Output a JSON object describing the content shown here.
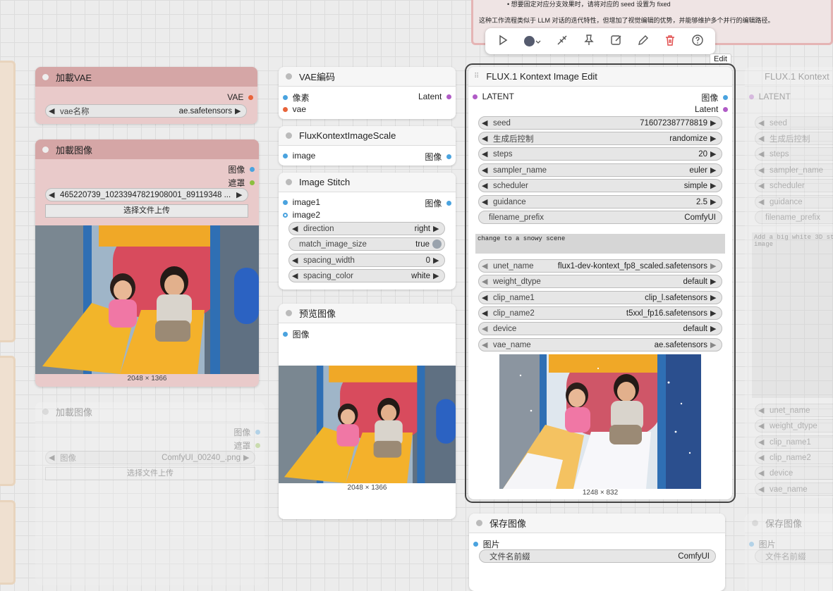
{
  "note": {
    "line1": "• 想要固定对应分支效果时，请将对应的 seed 设置为 fixed",
    "line2": "这种工作流程类似于 LLM 对话的迭代特性，但增加了视觉编辑的优势，并能够维护多个并行的编辑路径。"
  },
  "toolbar": {
    "tooltip": "Edit"
  },
  "load_vae": {
    "title": "加載VAE",
    "out": "VAE",
    "w_name": "vae名称",
    "w_value": "ae.safetensors"
  },
  "load_image": {
    "title": "加載图像",
    "out1": "图像",
    "out2": "遮罩",
    "file": "465220739_10233947821908001_89119348 ...",
    "upload": "选择文件上传",
    "size": "2048 × 1366"
  },
  "load_image2": {
    "title": "加載图像",
    "out1": "图像",
    "out2": "遮罩",
    "w_name": "图像",
    "w_value": "ComfyUI_00240_.png",
    "upload": "选择文件上传"
  },
  "vae_encode": {
    "title": "VAE編码",
    "in1": "像素",
    "in2": "vae",
    "out": "Latent"
  },
  "scale": {
    "title": "FluxKontextImageScale",
    "in": "image",
    "out": "图像"
  },
  "stitch": {
    "title": "Image Stitch",
    "in1": "image1",
    "in2": "image2",
    "out": "图像",
    "widgets": [
      {
        "name": "direction",
        "value": "right"
      },
      {
        "name": "match_image_size",
        "value": "true"
      },
      {
        "name": "spacing_width",
        "value": "0"
      },
      {
        "name": "spacing_color",
        "value": "white"
      }
    ]
  },
  "preview": {
    "title": "预览图像",
    "in": "图像",
    "size": "2048 × 1366"
  },
  "flux": {
    "title": "FLUX.1 Kontext Image Edit",
    "in": "LATENT",
    "out1": "图像",
    "out2": "Latent",
    "widgets": [
      {
        "name": "seed",
        "value": "716072387778819"
      },
      {
        "name": "生成后控制",
        "value": "randomize"
      },
      {
        "name": "steps",
        "value": "20"
      },
      {
        "name": "sampler_name",
        "value": "euler"
      },
      {
        "name": "scheduler",
        "value": "simple"
      },
      {
        "name": "guidance",
        "value": "2.5"
      },
      {
        "name": "filename_prefix",
        "value": "ComfyUI"
      }
    ],
    "prompt": "change to a snowy scene",
    "widgets2": [
      {
        "name": "unet_name",
        "value": "flux1-dev-kontext_fp8_scaled.safetensors"
      },
      {
        "name": "weight_dtype",
        "value": "default"
      },
      {
        "name": "clip_name1",
        "value": "clip_l.safetensors"
      },
      {
        "name": "clip_name2",
        "value": "t5xxl_fp16.safetensors"
      },
      {
        "name": "device",
        "value": "default"
      },
      {
        "name": "vae_name",
        "value": "ae.safetensors"
      }
    ],
    "size": "1248 × 832"
  },
  "flux2": {
    "title": "FLUX.1 Kontext",
    "in": "LATENT",
    "widgets": [
      "seed",
      "生成后控制",
      "steps",
      "sampler_name",
      "scheduler",
      "guidance",
      "filename_prefix"
    ],
    "prompt": "Add a big white 3D st\nimage",
    "widgets2": [
      "unet_name",
      "weight_dtype",
      "clip_name1",
      "clip_name2",
      "device",
      "vae_name"
    ]
  },
  "save": {
    "title": "保存图像",
    "in": "图片",
    "w_name": "文件名前綴",
    "w_value": "ComfyUI"
  },
  "save2": {
    "title": "保存图像",
    "in": "图片",
    "w_name": "文件名前綴"
  },
  "colors": {
    "vae": "#e8633a",
    "image": "#4aa3df",
    "mask": "#8cbf3f",
    "latent": "#b05bc6"
  }
}
